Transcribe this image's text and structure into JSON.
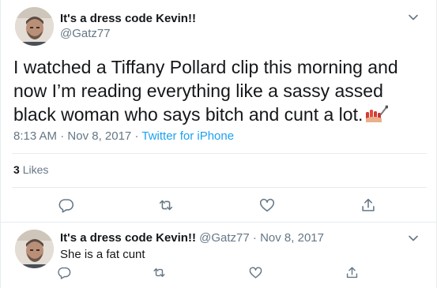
{
  "tweet": {
    "author_name": "It's a dress code Kevin!!",
    "author_handle": "@Gatz77",
    "text": "I watched a Tiffany Pollard clip this morning and now I’m reading everything like a sassy assed black woman who says bitch and cunt a lot.",
    "emoji_icon": "nail-polish-emoji",
    "time": "8:13 AM",
    "separator": "·",
    "date": "Nov 8, 2017",
    "source": "Twitter for iPhone",
    "likes_count": "3",
    "likes_label": "Likes",
    "actions": [
      "reply-icon",
      "retweet-icon",
      "like-icon",
      "share-icon"
    ]
  },
  "reply": {
    "author_name": "It's a dress code Kevin!!",
    "author_handle": "@Gatz77",
    "separator": "·",
    "date": "Nov 8, 2017",
    "text": "She is a fat cunt",
    "actions": [
      "reply-icon",
      "retweet-icon",
      "like-icon",
      "share-icon"
    ]
  },
  "colors": {
    "text": "#14171a",
    "secondary": "#657786",
    "link": "#1da1f2",
    "divider": "#e6ecf0"
  }
}
